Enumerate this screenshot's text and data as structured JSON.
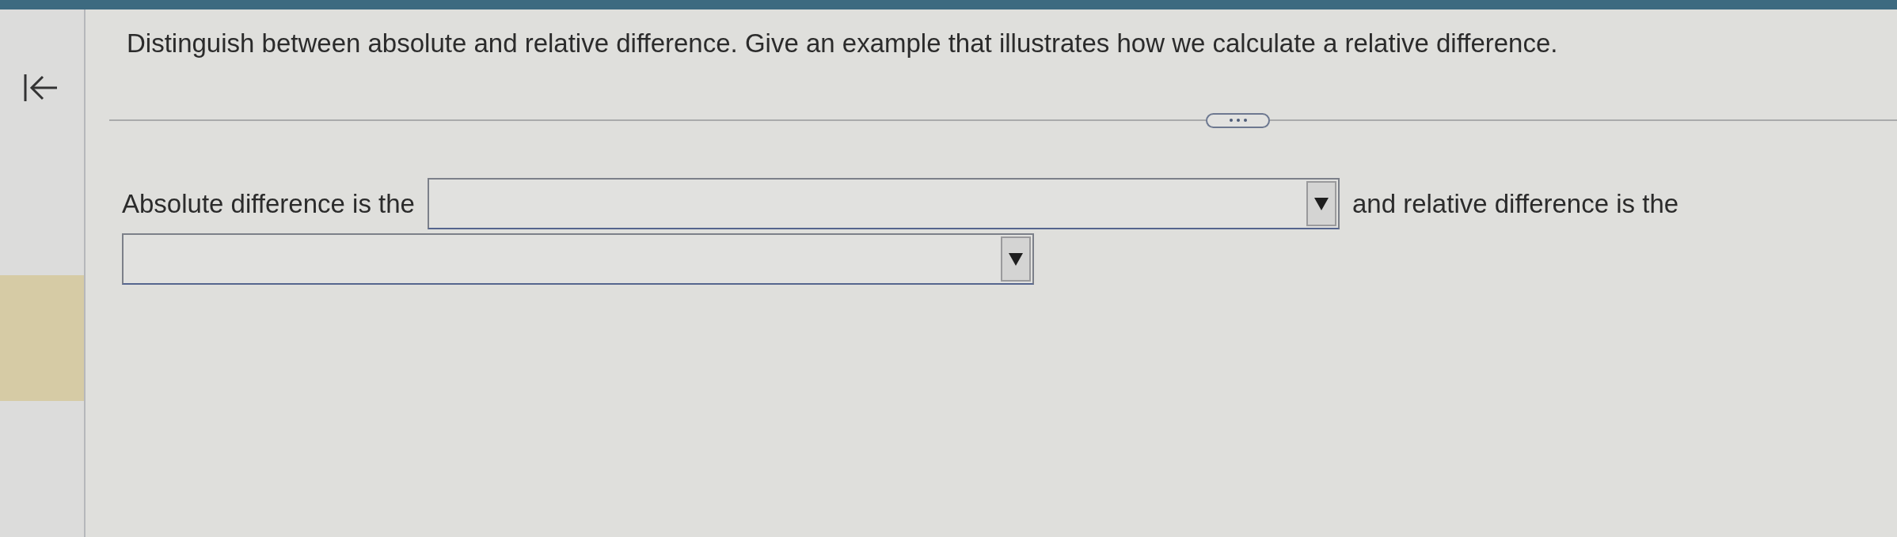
{
  "question": {
    "prompt": "Distinguish between absolute and relative difference. Give an example that illustrates how we calculate a relative difference."
  },
  "answer": {
    "parts": [
      {
        "kind": "text",
        "text": "Absolute difference is the"
      },
      {
        "kind": "dropdown"
      },
      {
        "kind": "text",
        "text": "and relative difference is the"
      },
      {
        "kind": "dropdown"
      }
    ]
  }
}
